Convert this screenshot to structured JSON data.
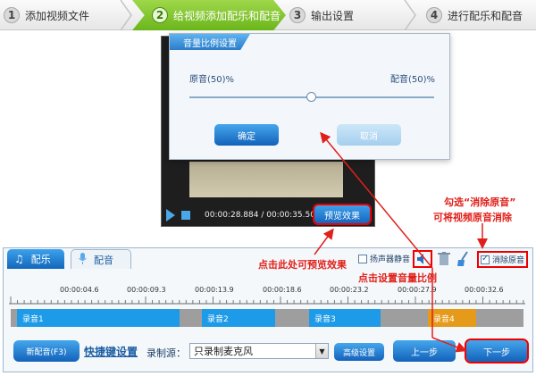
{
  "steps": [
    {
      "num": "1",
      "label": "添加视频文件"
    },
    {
      "num": "2",
      "label": "给视频添加配乐和配音"
    },
    {
      "num": "3",
      "label": "输出设置"
    },
    {
      "num": "4",
      "label": "进行配乐和配音"
    }
  ],
  "player": {
    "time": "00:00:28.884 / 00:00:35.500",
    "preview_label": "预览效果"
  },
  "dialog": {
    "title": "音量比例设置",
    "original_label": "原音(50)%",
    "dub_label": "配音(50)%",
    "ok_label": "确定",
    "cancel_label": "取消",
    "ratio": 0.5
  },
  "tabs": [
    {
      "label": "配乐"
    },
    {
      "label": "配音"
    }
  ],
  "toolbar": {
    "speaker_mute_label": "扬声器静音",
    "remove_original_label": "消除原音"
  },
  "timeline": {
    "ticks": [
      "00:00:04.6",
      "00:00:09.3",
      "00:00:13.9",
      "00:00:18.6",
      "00:00:23.2",
      "00:00:27.9",
      "00:00:32.6"
    ],
    "segments": [
      "录音1",
      "录音2",
      "录音3",
      "录音4"
    ]
  },
  "footer": {
    "new_dub_label": "新配音(F3)",
    "shortcut_label": "快捷键设置",
    "source_label": "录制源：",
    "source_value": "只录制麦克风",
    "advanced_label": "高级设置",
    "prev_label": "上一步",
    "next_label": "下一步"
  },
  "annotations": {
    "check_remove_1": "勾选“消除原音”",
    "check_remove_2": "可将视频原音消除",
    "click_preview": "点击此处可预览效果",
    "click_volume": "点击设置音量比例"
  },
  "colors": {
    "accent": "#1a6fc4",
    "active_step": "#7cc428",
    "annotation": "#e0201a",
    "segment_blue": "#1e9be8",
    "segment_orange": "#e59a1a"
  }
}
